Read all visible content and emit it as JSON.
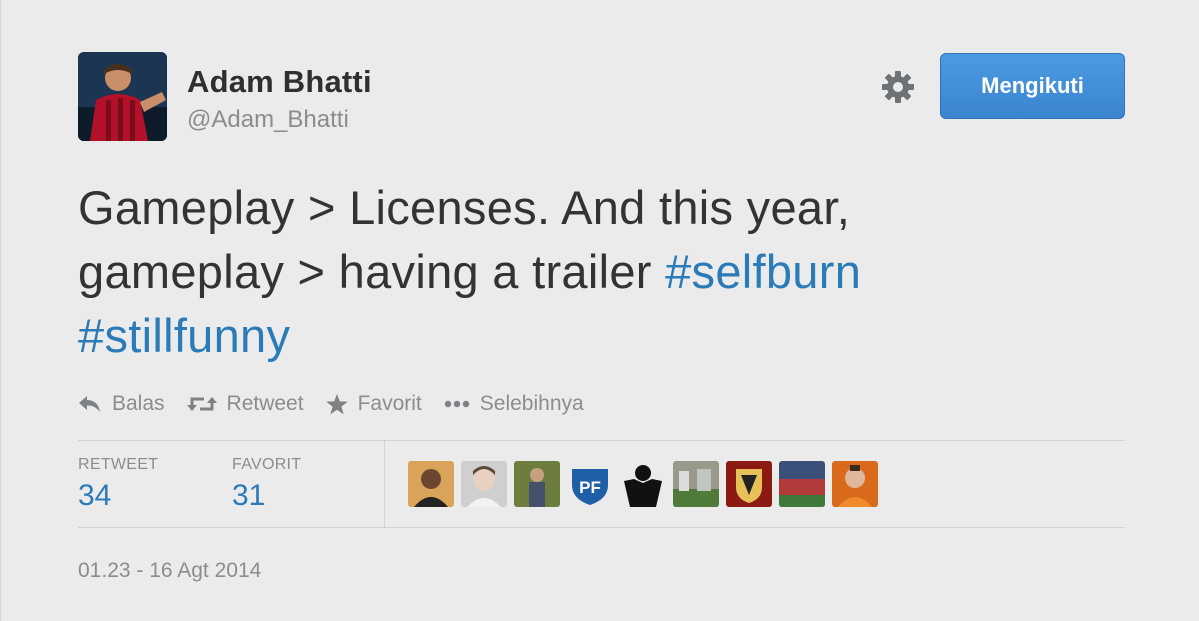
{
  "profile": {
    "name": "Adam Bhatti",
    "handle": "@Adam_Bhatti",
    "follow_label": "Mengikuti"
  },
  "tweet": {
    "line1": "Gameplay > Licenses. And this year,",
    "line2_text": "gameplay > having a trailer ",
    "hashtag1": "#selfburn",
    "hashtag2": "#stillfunny"
  },
  "actions": {
    "reply": "Balas",
    "retweet": "Retweet",
    "favorite": "Favorit",
    "more": "Selebihnya"
  },
  "stats": {
    "retweet_label": "RETWEET",
    "retweet_count": "34",
    "favorite_label": "FAVORIT",
    "favorite_count": "31"
  },
  "timestamp": "01.23 - 16 Agt 2014",
  "colors": {
    "link": "#2b7bb9",
    "button": "#3b88d4",
    "text": "#333333",
    "muted": "#8a8d90"
  }
}
